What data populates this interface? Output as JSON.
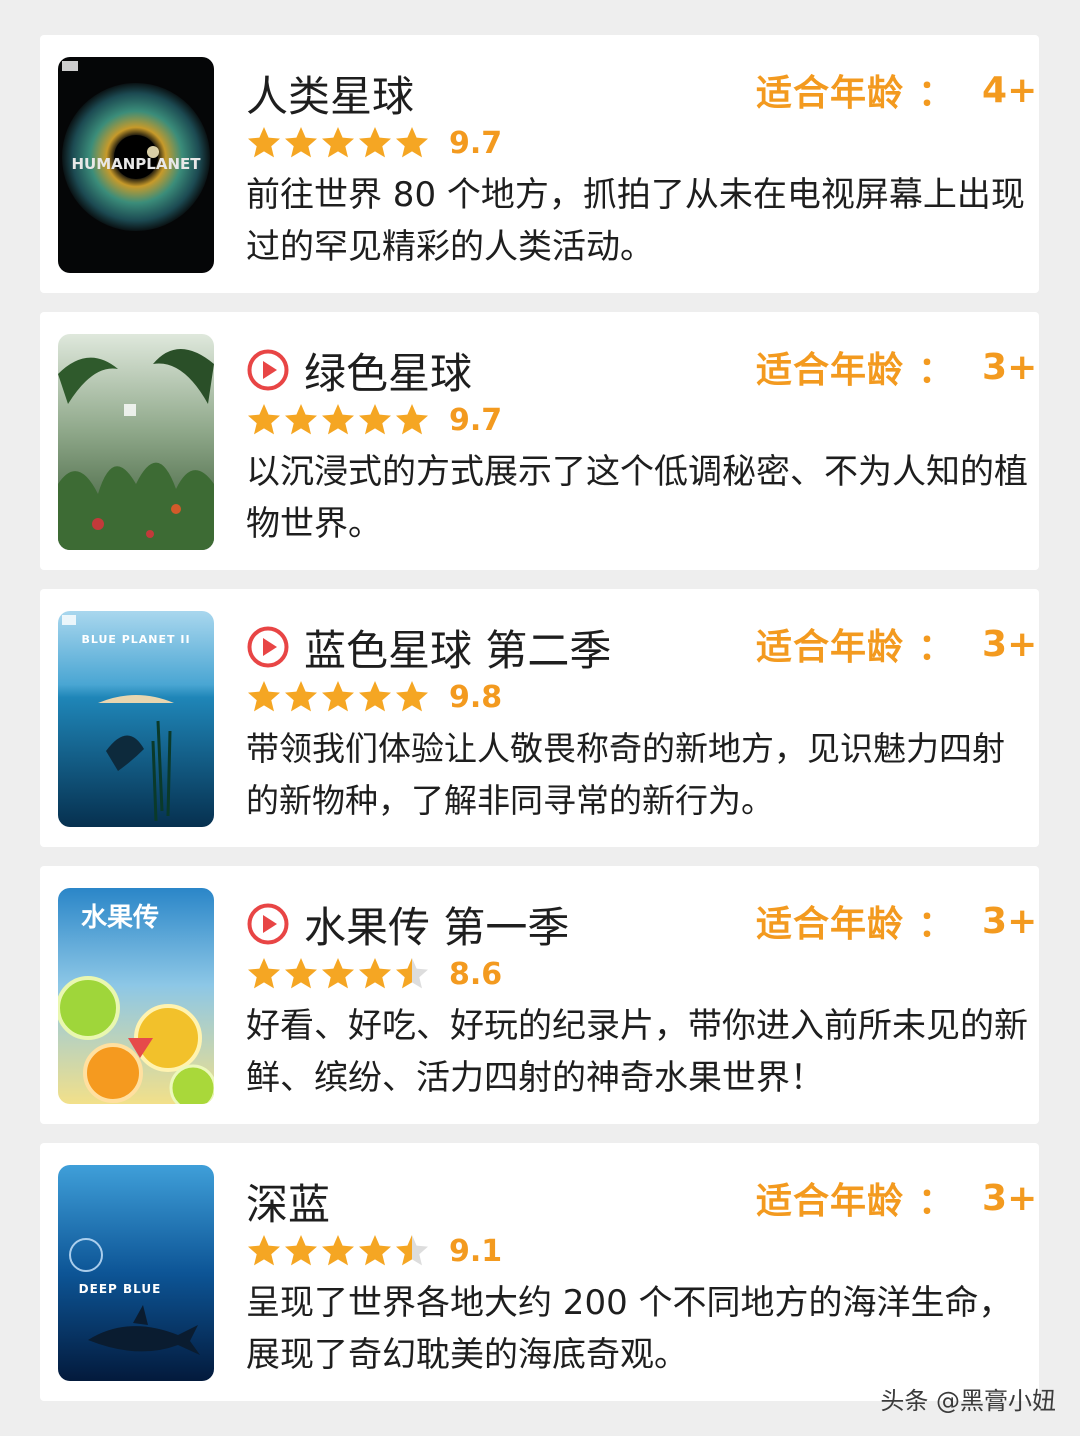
{
  "cards": [
    {
      "title": "人类星球",
      "has_play_icon": false,
      "age_label": "适合年龄",
      "age_colon": "：",
      "age_value": "4+",
      "rating": 9.7,
      "rating_text": "9.7",
      "stars": 5,
      "description": "前往世界 80 个地方，抓拍了从未在电视屏幕上出现过的罕见精彩的人类活动。",
      "poster_text": "HUMANPLANET",
      "poster_icon": "eye-icon"
    },
    {
      "title": "绿色星球",
      "has_play_icon": true,
      "age_label": "适合年龄",
      "age_colon": "：",
      "age_value": "3+",
      "rating": 9.7,
      "rating_text": "9.7",
      "stars": 5,
      "description": "以沉浸式的方式展示了这个低调秘密、不为人知的植物世界。",
      "poster_text": "",
      "poster_icon": "jungle-icon"
    },
    {
      "title": "蓝色星球 第二季",
      "has_play_icon": true,
      "age_label": "适合年龄",
      "age_colon": "：",
      "age_value": "3+",
      "rating": 9.8,
      "rating_text": "9.8",
      "stars": 5,
      "description": "带领我们体验让人敬畏称奇的新地方，见识魅力四射的新物种，了解非同寻常的新行为。",
      "poster_text": "BLUE PLANET II",
      "poster_icon": "ocean-icon"
    },
    {
      "title": "水果传 第一季",
      "has_play_icon": true,
      "age_label": "适合年龄",
      "age_colon": "：",
      "age_value": "3+",
      "rating": 8.6,
      "rating_text": "8.6",
      "stars": 4.5,
      "description": "好看、好吃、好玩的纪录片，带你进入前所未见的新鲜、缤纷、活力四射的神奇水果世界！",
      "poster_text": "水果传",
      "poster_icon": "citrus-icon"
    },
    {
      "title": "深蓝",
      "has_play_icon": false,
      "age_label": "适合年龄",
      "age_colon": "：",
      "age_value": "3+",
      "rating": 9.1,
      "rating_text": "9.1",
      "stars": 4.5,
      "description": "呈现了世界各地大约 200 个不同地方的海洋生命，展现了奇幻耽美的海底奇观。",
      "poster_text": "DEEP BLUE",
      "poster_icon": "shark-icon"
    }
  ],
  "colors": {
    "accent": "#f39a1f",
    "star": "#f5a623",
    "star_empty": "#dddddd",
    "play": "#e84545",
    "text": "#1e1e1e",
    "background": "#eeeeee"
  },
  "watermark": "头条 @黑膏小妞"
}
